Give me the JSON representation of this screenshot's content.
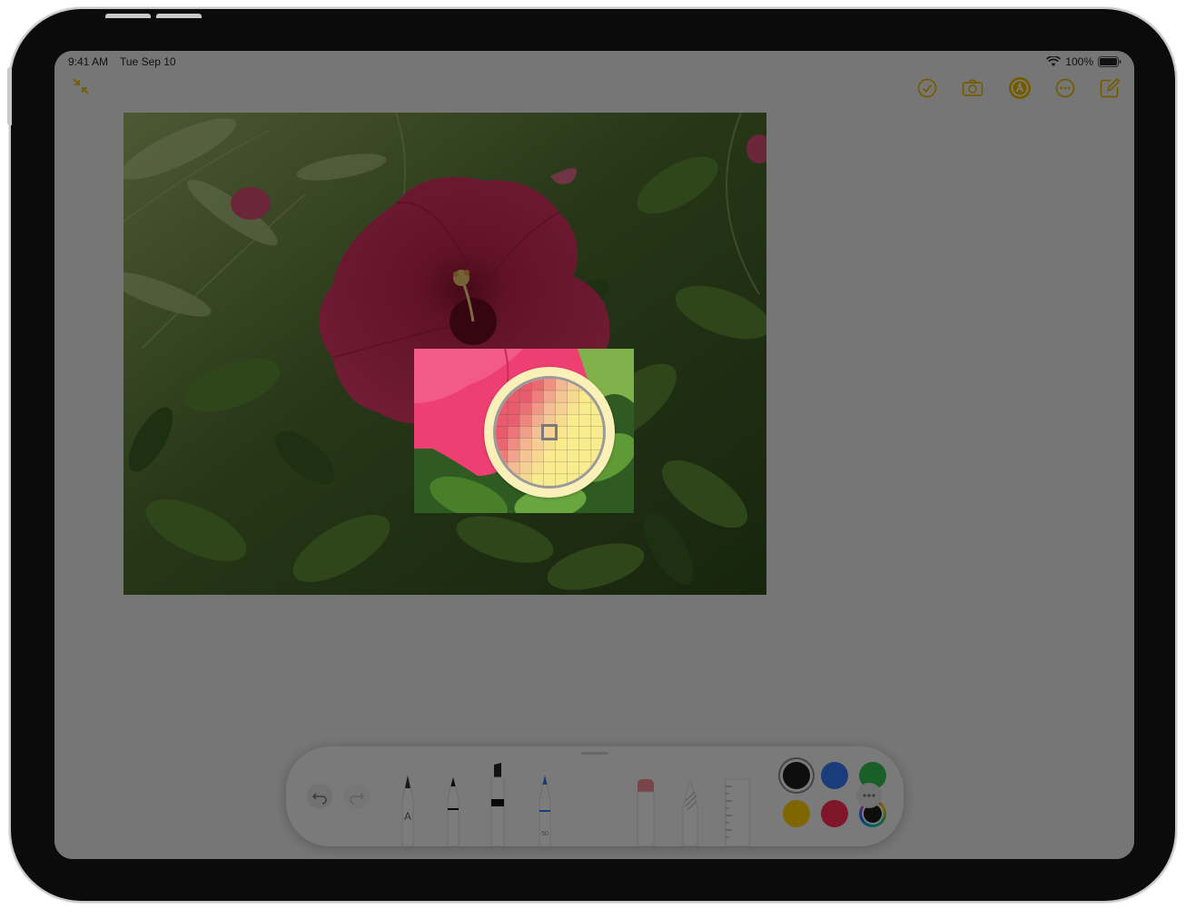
{
  "status_bar": {
    "time": "9:41 AM",
    "date": "Tue Sep 10",
    "battery_percent": "100%",
    "wifi_icon": "wifi-icon",
    "battery_icon": "battery-icon"
  },
  "top_toolbar": {
    "icons": [
      "collapse-arrows-icon",
      "checklist-icon",
      "camera-icon",
      "markup-icon",
      "more-options-icon",
      "compose-icon"
    ],
    "accent_color": "#e6b800",
    "markup_active": true
  },
  "note_image": {
    "subject": "pink hibiscus photo",
    "loupe": {
      "mode": "color picker",
      "selected_color": "#f7e98e"
    }
  },
  "tool_palette": {
    "undo_icon": "undo-icon",
    "redo_icon": "redo-icon",
    "tools": [
      "monoline-pen",
      "pen",
      "marker",
      "pencil-blue",
      "eraser",
      "fill-tool",
      "ruler"
    ],
    "pencil_size_label": "50",
    "pen_letter": "A",
    "colors": [
      "#1c1c1e",
      "#3478f6",
      "#30c04f",
      "#ffcc00",
      "#ff2d55",
      "custom"
    ],
    "selected_color": "#1c1c1e",
    "more_icon": "more-icon"
  }
}
